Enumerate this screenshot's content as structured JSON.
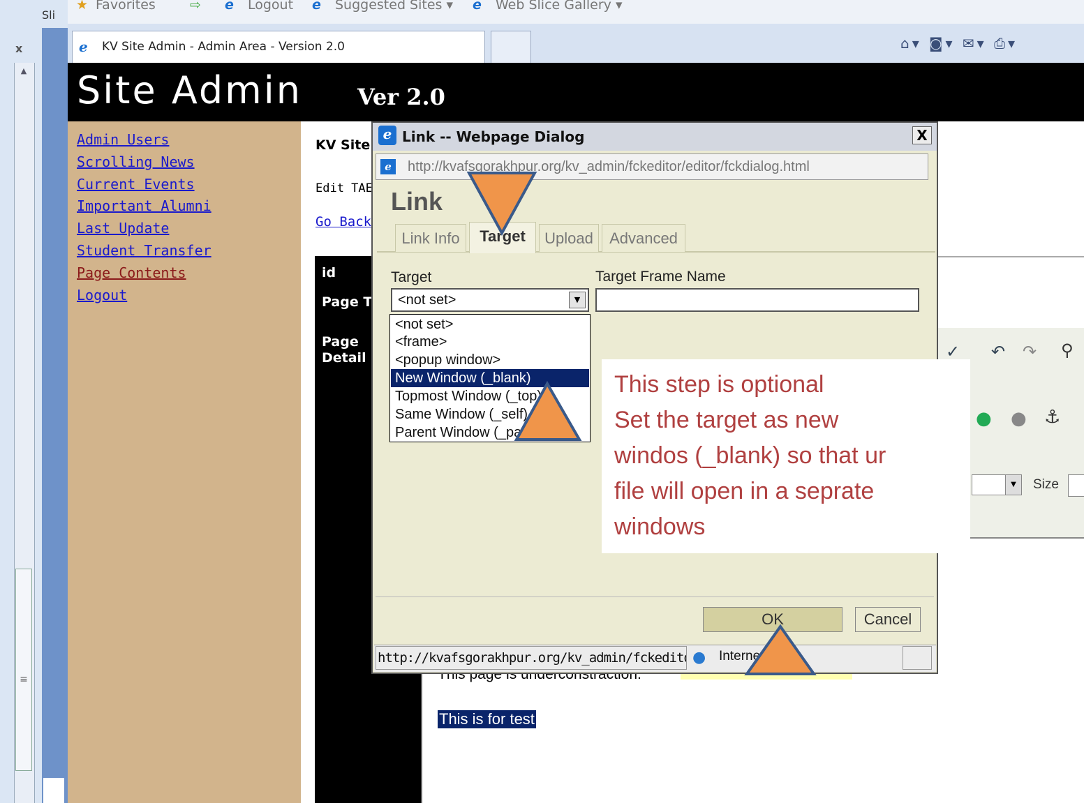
{
  "browser": {
    "slide_tab": "Sli",
    "slide_close": "x",
    "favorites": {
      "favorites_label": "Favorites",
      "logout_label": "Logout",
      "suggested_label": "Suggested Sites ▾",
      "webslice_label": "Web Slice Gallery ▾"
    },
    "tab_title": "KV Site Admin - Admin Area - Version 2.0",
    "tools": [
      "home-icon",
      "feeds-icon",
      "mail-icon",
      "print-icon"
    ]
  },
  "site": {
    "title": "Site Admin",
    "version": "Ver 2.0"
  },
  "sidebar": {
    "items": [
      {
        "label": "Admin Users"
      },
      {
        "label": "Scrolling News"
      },
      {
        "label": "Current Events"
      },
      {
        "label": "Important Alumni"
      },
      {
        "label": "Last Update"
      },
      {
        "label": "Student Transfer"
      },
      {
        "label": "Page Contents",
        "visited": true
      },
      {
        "label": "Logout"
      }
    ]
  },
  "main": {
    "title": "KV Site",
    "edit_label": "Edit TAE",
    "go_back": "Go Back",
    "col_id": "id",
    "col_page_title": "Page T",
    "col_page_detail_1": "Page",
    "col_page_detail_2": "Detail",
    "editor_text": "This page is underconstraction.",
    "editor_selected": "This is for test",
    "toolbar": {
      "size_label": "Size"
    }
  },
  "dialog": {
    "title": "Link -- Webpage Dialog",
    "close": "X",
    "url": "http://kvafsgorakhpur.org/kv_admin/fckeditor/editor/fckdialog.html",
    "heading": "Link",
    "tabs": [
      {
        "label": "Link Info"
      },
      {
        "label": "Target",
        "active": true
      },
      {
        "label": "Upload"
      },
      {
        "label": "Advanced"
      }
    ],
    "target_label": "Target",
    "target_value": "<not set>",
    "frame_label": "Target Frame Name",
    "frame_value": "",
    "options": [
      "<not set>",
      "<frame>",
      "<popup window>",
      "New Window (_blank)",
      "Topmost Window (_top)",
      "Same Window (_self)",
      "Parent Window (_parent)"
    ],
    "selected_option": "New Window (_blank)",
    "ok_label": "OK",
    "cancel_label": "Cancel",
    "status_url": "http://kvafsgorakhpur.org/kv_admin/fckeditor",
    "status_zone": "Internet"
  },
  "annotation": {
    "lines": [
      "This step is optional",
      "Set the target as new",
      "windos (_blank) so that ur",
      "file will open in a seprate",
      "windows"
    ],
    "arrow_color": "#f0954a",
    "arrow_stroke": "#3a5a8a",
    "text_color": "#b04040"
  },
  "colors": {
    "sidebar_bg": "#d2b48c",
    "header_bg": "#000000",
    "dialog_bg": "#ecebd3",
    "selection": "#0a246a"
  }
}
